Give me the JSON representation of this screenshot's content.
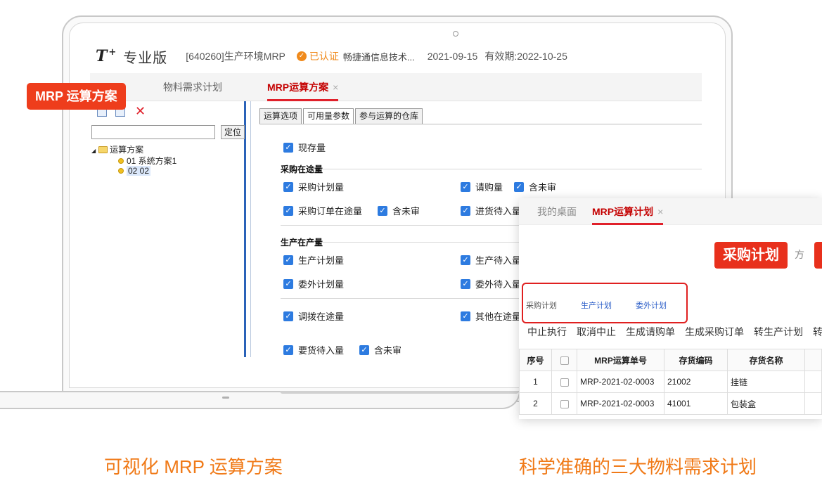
{
  "app": {
    "logo": "T",
    "logo_sup": "+",
    "edition": "专业版",
    "account": "[640260]生产环境MRP",
    "cert_icon": "cert-icon",
    "certified": "已认证",
    "company": "畅捷通信息技术...",
    "date": "2021-09-15",
    "expiry": "有效期:2022-10-25"
  },
  "tabs": {
    "items": [
      {
        "label": "物料需求计划"
      },
      {
        "label": "MRP运算方案",
        "close": "×"
      }
    ],
    "active": "MRP运算方案"
  },
  "left": {
    "search_placeholder": "",
    "locate_button": "定位",
    "tree": {
      "root": "运算方案",
      "items": [
        "01 系统方案1",
        "02 02"
      ],
      "selected": "02 02"
    }
  },
  "right": {
    "subtabs": [
      "运算选项",
      "可用量参数",
      "参与运算的仓库"
    ],
    "active_subtab": "可用量参数",
    "options": {
      "on_hand": "现存量",
      "purchase_section": "采购在途量",
      "purchase_plan": "采购计划量",
      "requisition": "请购量",
      "include_unapproved": "含未审",
      "po_in_transit": "采购订单在途量",
      "pending_receipt": "进货待入量",
      "production_section": "生产在产量",
      "production_plan": "生产计划量",
      "production_pending": "生产待入量",
      "outsource_plan": "委外计划量",
      "outsource_pending": "委外待入量",
      "transfer_in_transit": "调拨在途量",
      "other_in_transit": "其他在途量",
      "requisition_pending": "要货待入量"
    }
  },
  "popup": {
    "tabs": [
      "我的桌面",
      "MRP运算计划"
    ],
    "close": "×",
    "active_tab": "MRP运算计划",
    "banner": "采购计划",
    "banner_tail": "方",
    "subtabs": [
      "采购计划",
      "生产计划",
      "委外计划"
    ],
    "toolbar": [
      "中止执行",
      "取消中止",
      "生成请购单",
      "生成采购订单",
      "转生产计划",
      "转"
    ],
    "grid": {
      "columns": [
        "序号",
        "",
        "MRP运算单号",
        "存货编码",
        "存货名称"
      ],
      "rows": [
        [
          "1",
          "",
          "MRP-2021-02-0003",
          "21002",
          "挂链"
        ],
        [
          "2",
          "",
          "MRP-2021-02-0003",
          "41001",
          "包装盒"
        ]
      ]
    }
  },
  "callouts": {
    "left": "MRP 运算方案"
  },
  "captions": {
    "left": "可视化 MRP 运算方案",
    "right": "科学准确的三大物料需求计划"
  },
  "colors": {
    "accent_red": "#e0202a",
    "callout_orange": "#ee3d1c",
    "caption_orange": "#f07a18",
    "checkbox_blue": "#2d7be0"
  }
}
